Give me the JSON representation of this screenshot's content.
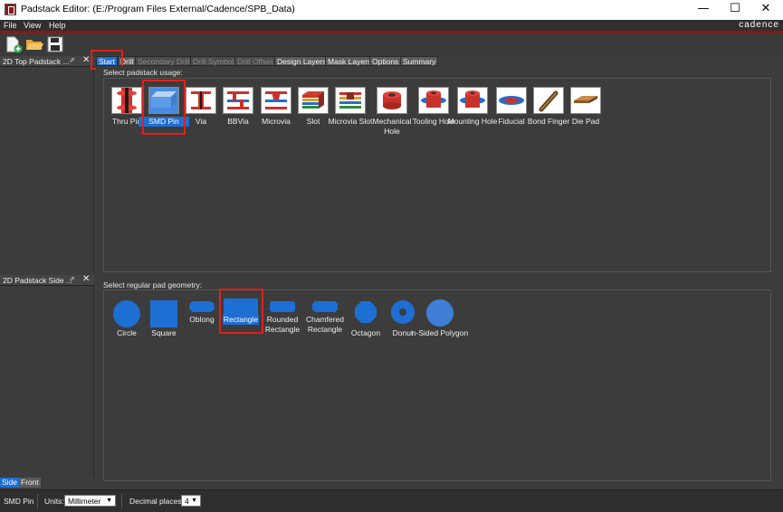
{
  "window": {
    "title": "Padstack Editor:  (E:/Program Files External/Cadence/SPB_Data)",
    "minimize": "—",
    "maximize": "☐",
    "close": "✕"
  },
  "menu": {
    "items": [
      "File",
      "View",
      "Help"
    ],
    "brand": "cadence"
  },
  "toolbar": {
    "buttons": [
      "new-file-icon",
      "open-folder-icon",
      "save-icon"
    ]
  },
  "panels": {
    "top": {
      "title": "2D Top Padstack ...",
      "pin": "⇗",
      "close": "✕"
    },
    "side": {
      "title": "2D Padstack Side ...",
      "pin": "⇗",
      "close": "✕"
    },
    "view_tabs": [
      "Side",
      "Front"
    ],
    "active_view_tab": "Side"
  },
  "tabs": [
    {
      "label": "Start",
      "state": "active"
    },
    {
      "label": "Drill",
      "state": "normal"
    },
    {
      "label": "Secondary Drill",
      "state": "disabled"
    },
    {
      "label": "Drill Symbol",
      "state": "disabled"
    },
    {
      "label": "Drill Offset",
      "state": "disabled"
    },
    {
      "label": "Design Layers",
      "state": "normal"
    },
    {
      "label": "Mask Layers",
      "state": "normal"
    },
    {
      "label": "Options",
      "state": "normal"
    },
    {
      "label": "Summary",
      "state": "normal"
    }
  ],
  "usage": {
    "label": "Select padstack usage:",
    "selected": "SMD Pin",
    "items": [
      {
        "label": "Thru Pin",
        "icon": "thru-pin-icon"
      },
      {
        "label": "SMD Pin",
        "icon": "smd-pin-icon"
      },
      {
        "label": "Via",
        "icon": "via-icon"
      },
      {
        "label": "BBVia",
        "icon": "bbvia-icon"
      },
      {
        "label": "Microvia",
        "icon": "microvia-icon"
      },
      {
        "label": "Slot",
        "icon": "slot-icon"
      },
      {
        "label": "Microvia Slot",
        "icon": "microvia-slot-icon"
      },
      {
        "label": "Mechanical Hole",
        "icon": "mechanical-hole-icon"
      },
      {
        "label": "Tooling Hole",
        "icon": "tooling-hole-icon"
      },
      {
        "label": "Mounting Hole",
        "icon": "mounting-hole-icon"
      },
      {
        "label": "Fiducial",
        "icon": "fiducial-icon"
      },
      {
        "label": "Bond Finger",
        "icon": "bond-finger-icon"
      },
      {
        "label": "Die Pad",
        "icon": "die-pad-icon"
      }
    ]
  },
  "geometry": {
    "label": "Select regular pad geometry:",
    "selected": "Rectangle",
    "items": [
      {
        "label": "Circle",
        "icon": "circle-shape-icon"
      },
      {
        "label": "Square",
        "icon": "square-shape-icon"
      },
      {
        "label": "Oblong",
        "icon": "oblong-shape-icon"
      },
      {
        "label": "Rectangle",
        "icon": "rectangle-shape-icon"
      },
      {
        "label": "Rounded Rectangle",
        "icon": "rounded-rectangle-shape-icon"
      },
      {
        "label": "Chamfered Rectangle",
        "icon": "chamfered-rectangle-shape-icon"
      },
      {
        "label": "Octagon",
        "icon": "octagon-shape-icon"
      },
      {
        "label": "Donut",
        "icon": "donut-shape-icon"
      },
      {
        "label": "n-Sided Polygon",
        "icon": "n-sided-polygon-shape-icon"
      }
    ]
  },
  "status": {
    "usage": "SMD Pin",
    "units_label": "Units:",
    "units_value": "Millimeter",
    "decimal_label": "Decimal places:",
    "decimal_value": "4",
    "dropdown_arrow": "▼"
  },
  "colors": {
    "accent": "#1e6fd4",
    "highlight": "#e0201c",
    "menu_border": "#b40000",
    "background": "#3c3c3c"
  }
}
